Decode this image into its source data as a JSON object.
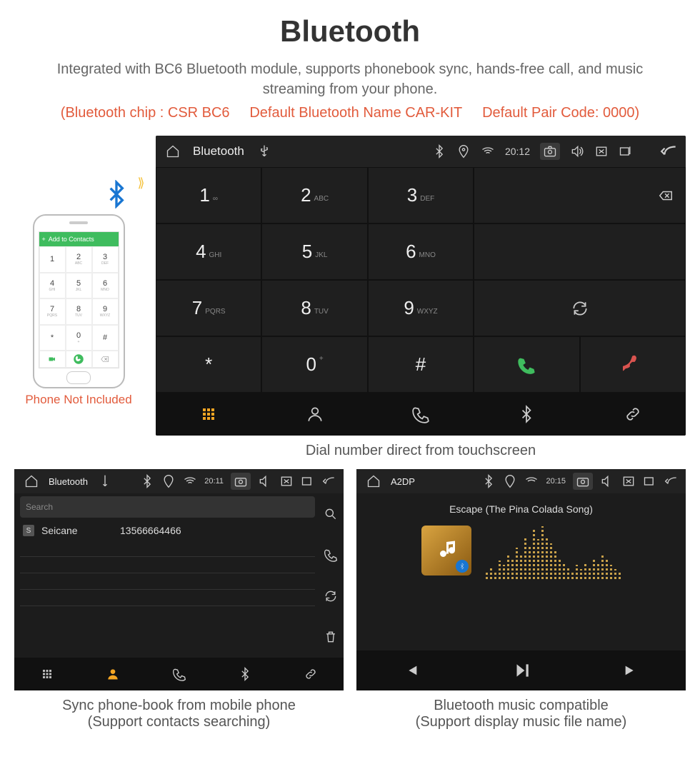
{
  "page": {
    "title": "Bluetooth",
    "subtitle": "Integrated with BC6 Bluetooth module, supports phonebook sync, hands-free call, and music streaming from your phone.",
    "spec_chip": "(Bluetooth chip : CSR BC6",
    "spec_name": "Default Bluetooth Name CAR-KIT",
    "spec_pair": "Default Pair Code: 0000)"
  },
  "phone": {
    "top_label": "Add to Contacts",
    "caption": "Phone Not Included",
    "keys": [
      {
        "n": "1",
        "s": ""
      },
      {
        "n": "2",
        "s": "ABC"
      },
      {
        "n": "3",
        "s": "DEF"
      },
      {
        "n": "4",
        "s": "GHI"
      },
      {
        "n": "5",
        "s": "JKL"
      },
      {
        "n": "6",
        "s": "MNO"
      },
      {
        "n": "7",
        "s": "PQRS"
      },
      {
        "n": "8",
        "s": "TUV"
      },
      {
        "n": "9",
        "s": "WXYZ"
      },
      {
        "n": "*",
        "s": ""
      },
      {
        "n": "0",
        "s": "+"
      },
      {
        "n": "#",
        "s": ""
      }
    ]
  },
  "dialer": {
    "status": {
      "title": "Bluetooth",
      "time": "20:12"
    },
    "keys": [
      {
        "n": "1",
        "s": "∞"
      },
      {
        "n": "2",
        "s": "ABC"
      },
      {
        "n": "3",
        "s": "DEF"
      },
      {
        "n": "4",
        "s": "GHI"
      },
      {
        "n": "5",
        "s": "JKL"
      },
      {
        "n": "6",
        "s": "MNO"
      },
      {
        "n": "7",
        "s": "PQRS"
      },
      {
        "n": "8",
        "s": "TUV"
      },
      {
        "n": "9",
        "s": "WXYZ"
      },
      {
        "n": "*",
        "s": ""
      },
      {
        "n": "0",
        "s": "+"
      },
      {
        "n": "#",
        "s": ""
      }
    ],
    "caption": "Dial number direct from touchscreen"
  },
  "contacts": {
    "status": {
      "title": "Bluetooth",
      "time": "20:11"
    },
    "search_placeholder": "Search",
    "entry_badge": "S",
    "entry_name": "Seicane",
    "entry_number": "13566664466",
    "caption_line1": "Sync phone-book from mobile phone",
    "caption_line2": "(Support contacts searching)"
  },
  "music": {
    "status": {
      "title": "A2DP",
      "time": "20:15"
    },
    "song": "Escape (The Pina Colada Song)",
    "caption_line1": "Bluetooth music compatible",
    "caption_line2": "(Support display music file name)"
  }
}
